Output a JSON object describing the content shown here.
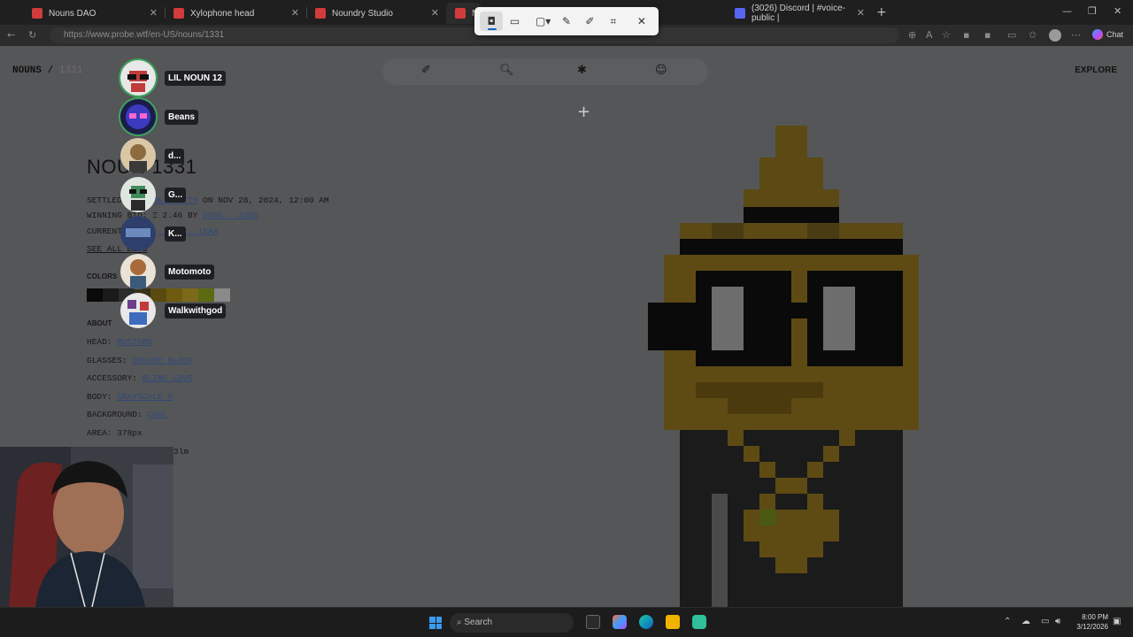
{
  "browser": {
    "tabs": [
      {
        "title": "Nouns DAO",
        "color": "#d13b3b"
      },
      {
        "title": "Xylophone head",
        "color": "#d13b3b"
      },
      {
        "title": "Noundry Studio",
        "color": "#d13b3b"
      },
      {
        "title": "No",
        "color": "#d13b3b"
      },
      {
        "title": "(3026) Discord | #voice-public |",
        "color": "#5865f2"
      }
    ],
    "url": "https://www.probe.wtf/en-US/nouns/1331",
    "chat_label": "Chat"
  },
  "page": {
    "breadcrumb_root": "NOUNS",
    "breadcrumb_sep": "/",
    "breadcrumb_num": "1331",
    "explore": "EXPLORE",
    "title": "NOUN 1331",
    "settled_prefix": "SETTLED",
    "settled_link": "...ISHGIRL.ETH",
    "settled_suffix": "ON NOV 28, 2024, 12:00 AM",
    "winning_bid_prefix": "WINNING BID: Ξ 2.46 BY",
    "winning_bid_link": "0XD6...24B5",
    "current_prefix": "CURRENT OWNER",
    "current_link": "...37...1EAA",
    "see_all_bids": "SEE ALL BIDS",
    "colors_label": "COLORS",
    "swatches": [
      "#0a0a0a",
      "#1a1a1a",
      "#2b2b2b",
      "#3a3118",
      "#5a4a0f",
      "#6e5b10",
      "#7a6a1a",
      "#5d6a14",
      "#8a8a8a"
    ],
    "about_label": "ABOUT",
    "attributes": [
      {
        "key": "HEAD:",
        "value": "MUSTARD"
      },
      {
        "key": "GLASSES:",
        "value": "SQUARE BLACK"
      },
      {
        "key": "ACCESSORY:",
        "value": "BLING LOVE"
      },
      {
        "key": "BODY:",
        "value": "GRAYSCALE 8"
      },
      {
        "key": "BACKGROUND:",
        "value": "COOL"
      }
    ],
    "area": "AREA: 378px",
    "brightness_partial": "3lm"
  },
  "participants": [
    {
      "name": "LIL NOUN 12",
      "speaking": true,
      "avatar": "#c23b3b"
    },
    {
      "name": "Beans",
      "speaking": true,
      "avatar": "#3b3bbf"
    },
    {
      "name": "d...",
      "speaking": false,
      "avatar": "#8b6b3f"
    },
    {
      "name": "G...",
      "speaking": false,
      "avatar": "#3f8b5a"
    },
    {
      "name": "K...",
      "speaking": false,
      "avatar": "#2f3f6b"
    },
    {
      "name": "Motomoto",
      "speaking": false,
      "avatar": "#a86a3a"
    },
    {
      "name": "Walkwithgod",
      "speaking": false,
      "avatar": "#6b3f8b"
    }
  ],
  "snipping_tool": {
    "icons": [
      "camera-icon",
      "video-icon",
      "rectangle-icon",
      "edit-icon",
      "pen-icon",
      "text-extract-icon",
      "close-icon"
    ]
  },
  "taskbar": {
    "search_placeholder": "Search",
    "time": "8:00 PM",
    "date": "3/12/2026"
  }
}
